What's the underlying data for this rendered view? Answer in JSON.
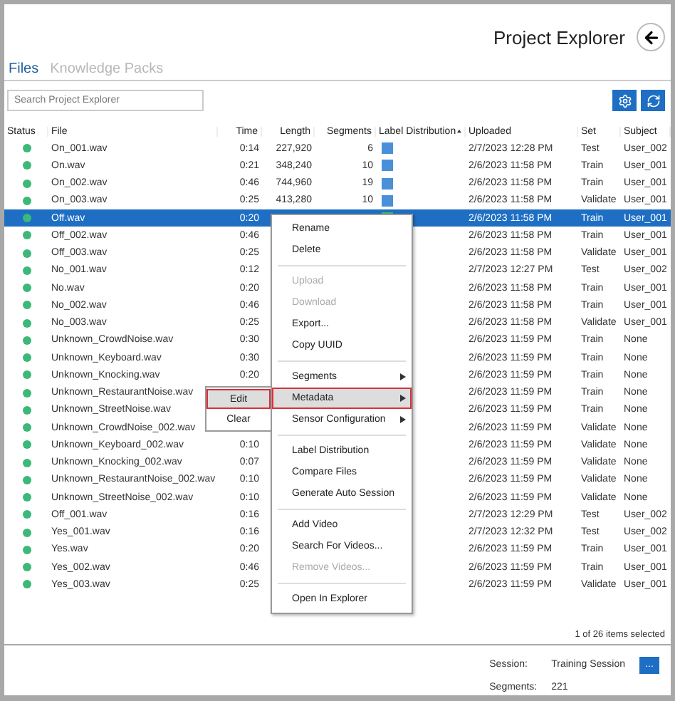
{
  "header": {
    "title": "Project Explorer"
  },
  "tabs": [
    {
      "label": "Files",
      "selected": true
    },
    {
      "label": "Knowledge Packs",
      "selected": false
    }
  ],
  "search": {
    "placeholder": "Search Project Explorer"
  },
  "table": {
    "columns": [
      {
        "label": "Status",
        "sorted": false
      },
      {
        "label": "File",
        "sorted": false
      },
      {
        "label": "Time",
        "sorted": false
      },
      {
        "label": "Length",
        "sorted": false
      },
      {
        "label": "Segments",
        "sorted": false
      },
      {
        "label": "Label Distribution",
        "sorted": true
      },
      {
        "label": "Uploaded",
        "sorted": false
      },
      {
        "label": "Set",
        "sorted": false
      },
      {
        "label": "Subject",
        "sorted": false
      }
    ],
    "rows": [
      {
        "online": true,
        "file": "On_001.wav",
        "time": "0:14",
        "length": "227,920",
        "segments": "6",
        "color": "#4a90d9",
        "uploaded": "2/7/2023 12:28 PM",
        "set": "Test",
        "subject": "User_002",
        "selected": false
      },
      {
        "online": true,
        "file": "On.wav",
        "time": "0:21",
        "length": "348,240",
        "segments": "10",
        "color": "#4a90d9",
        "uploaded": "2/6/2023 11:58 PM",
        "set": "Train",
        "subject": "User_001",
        "selected": false
      },
      {
        "online": true,
        "file": "On_002.wav",
        "time": "0:46",
        "length": "744,960",
        "segments": "19",
        "color": "#4a90d9",
        "uploaded": "2/6/2023 11:58 PM",
        "set": "Train",
        "subject": "User_001",
        "selected": false
      },
      {
        "online": true,
        "file": "On_003.wav",
        "time": "0:25",
        "length": "413,280",
        "segments": "10",
        "color": "#4a90d9",
        "uploaded": "2/6/2023 11:58 PM",
        "set": "Validate",
        "subject": "User_001",
        "selected": false
      },
      {
        "online": true,
        "file": "Off.wav",
        "time": "0:20",
        "color": "#3cb878",
        "uploaded": "2/6/2023 11:58 PM",
        "set": "Train",
        "subject": "User_001",
        "selected": true
      },
      {
        "online": true,
        "file": "Off_002.wav",
        "time": "0:46",
        "uploaded": "2/6/2023 11:58 PM",
        "set": "Train",
        "subject": "User_001",
        "selected": false
      },
      {
        "online": true,
        "file": "Off_003.wav",
        "time": "0:25",
        "uploaded": "2/6/2023 11:58 PM",
        "set": "Validate",
        "subject": "User_001",
        "selected": false
      },
      {
        "online": true,
        "file": "No_001.wav",
        "time": "0:12",
        "uploaded": "2/7/2023 12:27 PM",
        "set": "Test",
        "subject": "User_002",
        "selected": false
      },
      {
        "online": true,
        "file": "No.wav",
        "time": "0:20",
        "uploaded": "2/6/2023 11:58 PM",
        "set": "Train",
        "subject": "User_001",
        "selected": false
      },
      {
        "online": true,
        "file": "No_002.wav",
        "time": "0:46",
        "uploaded": "2/6/2023 11:58 PM",
        "set": "Train",
        "subject": "User_001",
        "selected": false
      },
      {
        "online": true,
        "file": "No_003.wav",
        "time": "0:25",
        "uploaded": "2/6/2023 11:58 PM",
        "set": "Validate",
        "subject": "User_001",
        "selected": false
      },
      {
        "online": true,
        "file": "Unknown_CrowdNoise.wav",
        "time": "0:30",
        "uploaded": "2/6/2023 11:59 PM",
        "set": "Train",
        "subject": "None",
        "selected": false
      },
      {
        "online": true,
        "file": "Unknown_Keyboard.wav",
        "time": "0:30",
        "uploaded": "2/6/2023 11:59 PM",
        "set": "Train",
        "subject": "None",
        "selected": false
      },
      {
        "online": true,
        "file": "Unknown_Knocking.wav",
        "time": "0:20",
        "uploaded": "2/6/2023 11:59 PM",
        "set": "Train",
        "subject": "None",
        "selected": false
      },
      {
        "online": true,
        "file": "Unknown_RestaurantNoise.wav",
        "uploaded": "2/6/2023 11:59 PM",
        "set": "Train",
        "subject": "None",
        "selected": false
      },
      {
        "online": true,
        "file": "Unknown_StreetNoise.wav",
        "uploaded": "2/6/2023 11:59 PM",
        "set": "Train",
        "subject": "None",
        "selected": false
      },
      {
        "online": true,
        "file": "Unknown_CrowdNoise_002.wav",
        "uploaded": "2/6/2023 11:59 PM",
        "set": "Validate",
        "subject": "None",
        "selected": false
      },
      {
        "online": true,
        "file": "Unknown_Keyboard_002.wav",
        "time": "0:10",
        "uploaded": "2/6/2023 11:59 PM",
        "set": "Validate",
        "subject": "None",
        "selected": false
      },
      {
        "online": true,
        "file": "Unknown_Knocking_002.wav",
        "time": "0:07",
        "uploaded": "2/6/2023 11:59 PM",
        "set": "Validate",
        "subject": "None",
        "selected": false
      },
      {
        "online": true,
        "file": "Unknown_RestaurantNoise_002.wav",
        "time": "0:10",
        "uploaded": "2/6/2023 11:59 PM",
        "set": "Validate",
        "subject": "None",
        "selected": false
      },
      {
        "online": true,
        "file": "Unknown_StreetNoise_002.wav",
        "time": "0:10",
        "uploaded": "2/6/2023 11:59 PM",
        "set": "Validate",
        "subject": "None",
        "selected": false
      },
      {
        "online": true,
        "file": "Off_001.wav",
        "time": "0:16",
        "uploaded": "2/7/2023 12:29 PM",
        "set": "Test",
        "subject": "User_002",
        "selected": false
      },
      {
        "online": true,
        "file": "Yes_001.wav",
        "time": "0:16",
        "uploaded": "2/7/2023 12:32 PM",
        "set": "Test",
        "subject": "User_002",
        "selected": false
      },
      {
        "online": true,
        "file": "Yes.wav",
        "time": "0:20",
        "uploaded": "2/6/2023 11:59 PM",
        "set": "Train",
        "subject": "User_001",
        "selected": false
      },
      {
        "online": true,
        "file": "Yes_002.wav",
        "time": "0:46",
        "uploaded": "2/6/2023 11:59 PM",
        "set": "Train",
        "subject": "User_001",
        "selected": false
      },
      {
        "online": true,
        "file": "Yes_003.wav",
        "time": "0:25",
        "uploaded": "2/6/2023 11:59 PM",
        "set": "Validate",
        "subject": "User_001",
        "selected": false
      }
    ]
  },
  "context_menu": {
    "groups": [
      [
        {
          "label": "Rename",
          "disabled": false,
          "submenu": false,
          "highlighted": false
        },
        {
          "label": "Delete",
          "disabled": false,
          "submenu": false,
          "highlighted": false
        }
      ],
      [
        {
          "label": "Upload",
          "disabled": true,
          "submenu": false,
          "highlighted": false
        },
        {
          "label": "Download",
          "disabled": true,
          "submenu": false,
          "highlighted": false
        },
        {
          "label": "Export...",
          "disabled": false,
          "submenu": false,
          "highlighted": false
        },
        {
          "label": "Copy UUID",
          "disabled": false,
          "submenu": false,
          "highlighted": false
        }
      ],
      [
        {
          "label": "Segments",
          "disabled": false,
          "submenu": true,
          "highlighted": false
        },
        {
          "label": "Metadata",
          "disabled": false,
          "submenu": true,
          "highlighted": true
        },
        {
          "label": "Sensor Configuration",
          "disabled": false,
          "submenu": true,
          "highlighted": false
        }
      ],
      [
        {
          "label": "Label Distribution",
          "disabled": false,
          "submenu": false,
          "highlighted": false
        },
        {
          "label": "Compare Files",
          "disabled": false,
          "submenu": false,
          "highlighted": false
        },
        {
          "label": "Generate Auto Session",
          "disabled": false,
          "submenu": false,
          "highlighted": false
        }
      ],
      [
        {
          "label": "Add Video",
          "disabled": false,
          "submenu": false,
          "highlighted": false
        },
        {
          "label": "Search For Videos...",
          "disabled": false,
          "submenu": false,
          "highlighted": false
        },
        {
          "label": "Remove Videos...",
          "disabled": true,
          "submenu": false,
          "highlighted": false
        }
      ],
      [
        {
          "label": "Open In Explorer",
          "disabled": false,
          "submenu": false,
          "highlighted": false
        }
      ]
    ]
  },
  "submenu": {
    "items": [
      {
        "label": "Edit",
        "highlighted": true
      },
      {
        "label": "Clear",
        "highlighted": false
      }
    ]
  },
  "selection_status": "1 of 26 items selected",
  "footer": {
    "session_label": "Session:",
    "session_value": "Training Session",
    "session_button": "...",
    "segments_label": "Segments:",
    "segments_value": "221"
  }
}
